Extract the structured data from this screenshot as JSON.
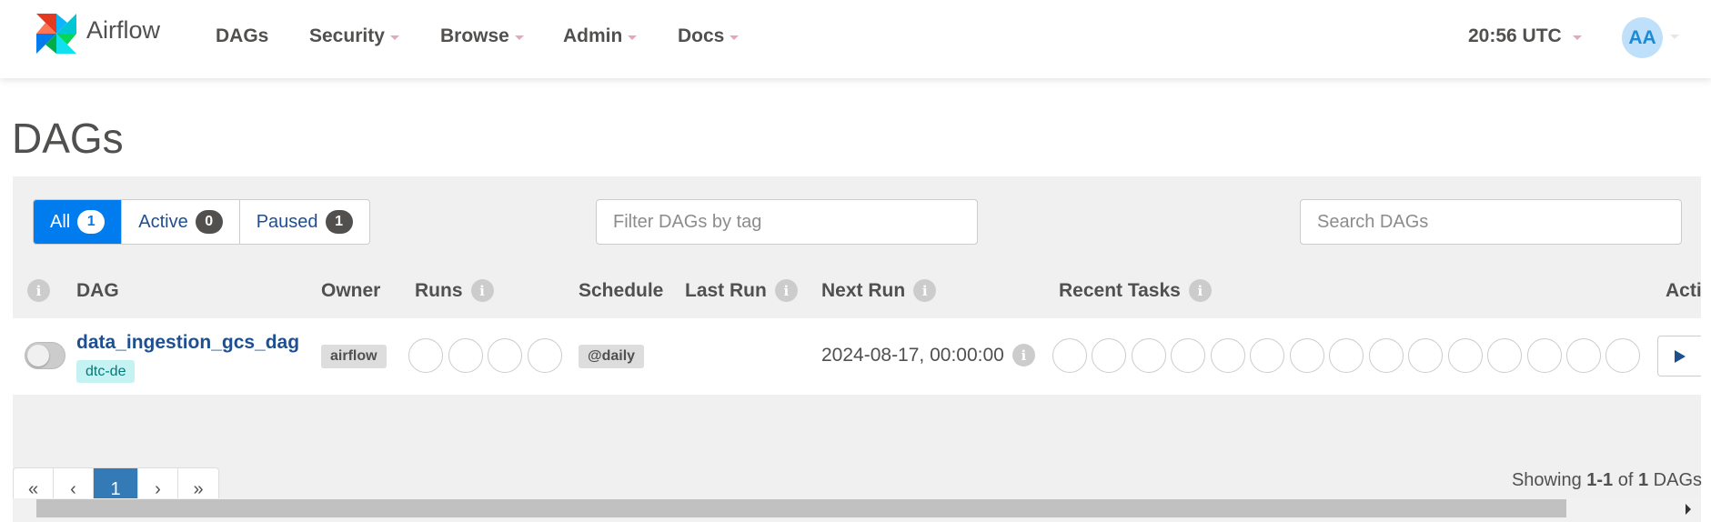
{
  "brand": {
    "name": "Airflow"
  },
  "nav": {
    "items": [
      {
        "label": "DAGs",
        "has_dropdown": false
      },
      {
        "label": "Security",
        "has_dropdown": true
      },
      {
        "label": "Browse",
        "has_dropdown": true
      },
      {
        "label": "Admin",
        "has_dropdown": true
      },
      {
        "label": "Docs",
        "has_dropdown": true
      }
    ],
    "time": "20:56 UTC",
    "user_initials": "AA"
  },
  "page": {
    "title": "DAGs"
  },
  "status_filter": {
    "all": {
      "label": "All",
      "count": "1",
      "active": true
    },
    "active": {
      "label": "Active",
      "count": "0"
    },
    "paused": {
      "label": "Paused",
      "count": "1"
    }
  },
  "filters": {
    "tag_placeholder": "Filter DAGs by tag",
    "search_placeholder": "Search DAGs"
  },
  "table": {
    "headers": {
      "dag": "DAG",
      "owner": "Owner",
      "runs": "Runs",
      "schedule": "Schedule",
      "last_run": "Last Run",
      "next_run": "Next Run",
      "recent_tasks": "Recent Tasks",
      "actions": "Acti"
    },
    "info_icon": "i",
    "rows": [
      {
        "dag_id": "data_ingestion_gcs_dag",
        "tag": "dtc-de",
        "owner": "airflow",
        "schedule": "@daily",
        "next_run": "2024-08-17, 00:00:00",
        "paused": true
      }
    ]
  },
  "pagination": {
    "first": "«",
    "prev": "‹",
    "current": "1",
    "next": "›",
    "last": "»"
  },
  "footer": {
    "showing_prefix": "Showing",
    "range": "1-1",
    "of": "of",
    "total": "1",
    "suffix": "DAGs"
  },
  "colors": {
    "primary": "#017cee",
    "link": "#1d4f91",
    "well": "#f0f0f0",
    "tag_bg": "#c5f2f2",
    "avatar_bg": "#bfe0fb"
  }
}
